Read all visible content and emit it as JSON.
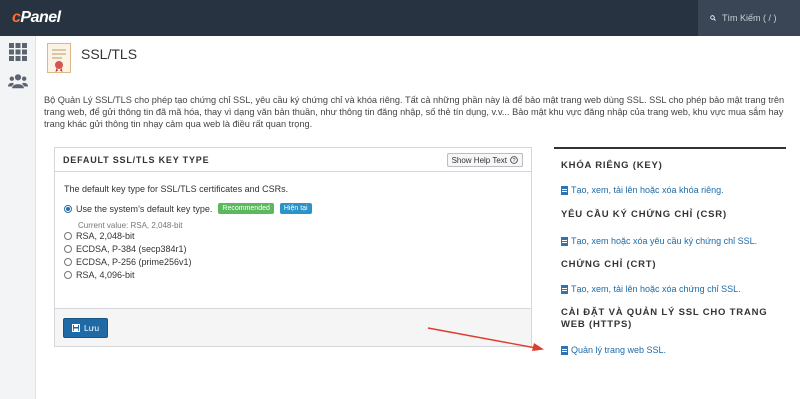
{
  "topbar": {
    "logo_prefix": "c",
    "logo_rest": "Panel",
    "search_placeholder": "Tìm Kiếm ( / )"
  },
  "header": {
    "title": "SSL/TLS",
    "description": "Bộ Quản Lý SSL/TLS cho phép tạo chứng chỉ SSL, yêu cầu ký chứng chỉ và khóa riêng. Tất cả những phần này là để bảo mật trang web dùng SSL. SSL cho phép bảo mật trang trên trang web, để gửi thông tin đã mã hóa, thay vì dạng văn bản thuần, như thông tin đăng nhập, số thẻ tín dụng, v.v... Bảo mật khu vực đăng nhập của trang web, khu vực mua sắm hay trang khác gửi thông tin nhạy cảm qua web là điều rất quan trọng."
  },
  "key_panel": {
    "title": "DEFAULT SSL/TLS KEY TYPE",
    "help_label": "Show Help Text",
    "intro": "The default key type for SSL/TLS certificates and CSRs.",
    "options": [
      {
        "label": "Use the system’s default key type.",
        "checked": true
      },
      {
        "label": "RSA, 2,048-bit",
        "checked": false
      },
      {
        "label": "ECDSA, P-384 (secp384r1)",
        "checked": false
      },
      {
        "label": "ECDSA, P-256 (prime256v1)",
        "checked": false
      },
      {
        "label": "RSA, 4,096-bit",
        "checked": false
      }
    ],
    "badge_recommended": "Recommended",
    "badge_current": "Hiện tại",
    "current_value": "Current value: RSA, 2,048-bit",
    "save_label": "Lưu"
  },
  "right_sections": [
    {
      "title": "KHÓA RIÊNG (KEY)",
      "link": "Tạo, xem, tải lên hoặc xóa khóa riêng."
    },
    {
      "title": "YÊU CẦU KÝ CHỨNG CHỈ (CSR)",
      "link": "Tạo, xem hoặc xóa yêu cầu ký chứng chỉ SSL."
    },
    {
      "title": "CHỨNG CHỈ (CRT)",
      "link": "Tạo, xem, tải lên hoặc xóa chứng chỉ SSL."
    },
    {
      "title": "CÀI ĐẶT VÀ QUẢN LÝ SSL CHO TRANG WEB (HTTPS)",
      "link": "Quản lý trang web SSL."
    }
  ],
  "colors": {
    "topbar": "#283342",
    "link": "#1f6aa5",
    "primary_button": "#1f6aa5",
    "badge_recommended": "#5cb85c",
    "badge_current": "#2a93c8",
    "annotation_arrow": "#e03c2c"
  },
  "icons": [
    "search-icon",
    "grid-icon",
    "users-icon",
    "certificate-icon",
    "help-icon",
    "save-icon",
    "document-icon"
  ]
}
